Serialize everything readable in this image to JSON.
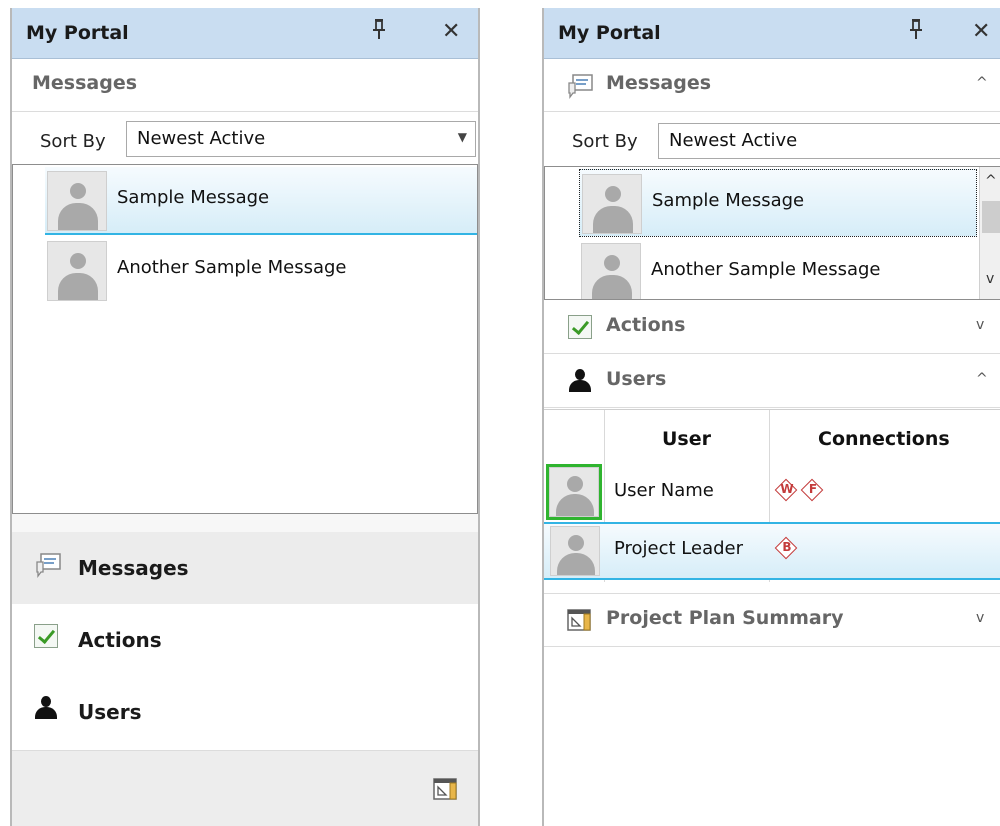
{
  "left_panel": {
    "title": "My Portal",
    "section_title": "Messages",
    "sort_label": "Sort By",
    "sort_value": "Newest Active",
    "messages": [
      "Sample Message",
      "Another Sample Message"
    ],
    "nav": {
      "messages": "Messages",
      "actions": "Actions",
      "users": "Users"
    }
  },
  "right_panel": {
    "title": "My Portal",
    "sections": {
      "messages": "Messages",
      "actions": "Actions",
      "users": "Users",
      "project_plan": "Project Plan Summary"
    },
    "sort_label": "Sort By",
    "sort_value": "Newest Active",
    "messages": [
      "Sample Message",
      "Another Sample Message"
    ],
    "users_grid": {
      "headers": [
        "User",
        "Connections"
      ],
      "rows": [
        {
          "name": "User Name",
          "connections": [
            "W",
            "F"
          ]
        },
        {
          "name": "Project Leader",
          "connections": [
            "B"
          ]
        }
      ]
    }
  },
  "colors": {
    "titlebar": "#c9ddf1",
    "selection_line": "#32b4e4",
    "selected_avatar_border": "#2fb42f",
    "badge": "#c43b3b",
    "check": "#3a9a26"
  },
  "icons": {
    "pin": "pin-icon",
    "close": "close-icon",
    "messages": "messages-icon",
    "actions": "checkmark-icon",
    "users": "user-icon",
    "project_plan": "project-plan-icon"
  }
}
